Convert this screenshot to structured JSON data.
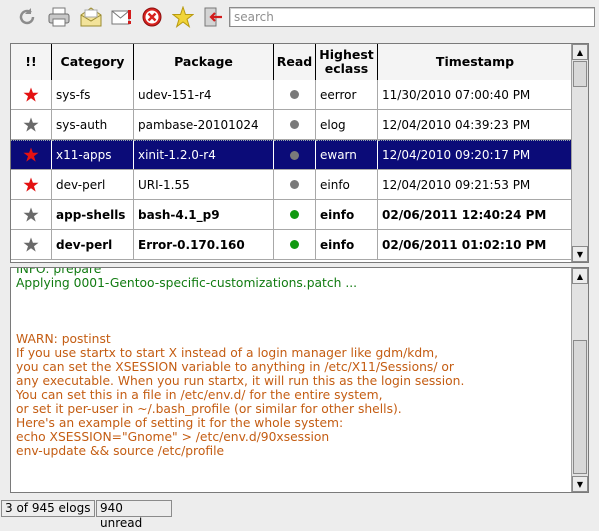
{
  "toolbar": {
    "icons": [
      "refresh-icon",
      "print-icon",
      "mail-open-icon",
      "mail-icon",
      "cancel-icon",
      "star-icon",
      "exit-icon"
    ],
    "search_placeholder": "search"
  },
  "table": {
    "headers": [
      "!!",
      "Category",
      "Package",
      "Read",
      "Highest eclass",
      "Timestamp"
    ],
    "rows": [
      {
        "star": "red",
        "category": "sys-fs",
        "package": "udev-151-r4",
        "read": "grey",
        "eclass": "eerror",
        "timestamp": "11/30/2010 07:00:40 PM",
        "selected": false,
        "unread": false
      },
      {
        "star": "grey",
        "category": "sys-auth",
        "package": "pambase-20101024",
        "read": "grey",
        "eclass": "elog",
        "timestamp": "12/04/2010 04:39:23 PM",
        "selected": false,
        "unread": false
      },
      {
        "star": "red",
        "category": "x11-apps",
        "package": "xinit-1.2.0-r4",
        "read": "grey",
        "eclass": "ewarn",
        "timestamp": "12/04/2010 09:20:17 PM",
        "selected": true,
        "unread": false
      },
      {
        "star": "red",
        "category": "dev-perl",
        "package": "URI-1.55",
        "read": "grey",
        "eclass": "einfo",
        "timestamp": "12/04/2010 09:21:53 PM",
        "selected": false,
        "unread": false
      },
      {
        "star": "grey",
        "category": "app-shells",
        "package": "bash-4.1_p9",
        "read": "green",
        "eclass": "einfo",
        "timestamp": "02/06/2011 12:40:24 PM",
        "selected": false,
        "unread": true
      },
      {
        "star": "grey",
        "category": "dev-perl",
        "package": "Error-0.170.160",
        "read": "green",
        "eclass": "einfo",
        "timestamp": "02/06/2011 01:02:10 PM",
        "selected": false,
        "unread": true
      }
    ]
  },
  "colors": {
    "star_red": "#e41212",
    "star_grey": "#6a6a6a",
    "read_grey": "#7a7a7a",
    "read_green": "#119a11",
    "selection": "#0b0b78",
    "log_green": "#117b11",
    "log_orange": "#c45d13"
  },
  "log": {
    "lines": [
      {
        "text": "INFO: prepare",
        "color": "green"
      },
      {
        "text": "Applying 0001-Gentoo-specific-customizations.patch ...",
        "color": "green"
      },
      {
        "text": "",
        "color": "green"
      },
      {
        "text": "",
        "color": "green"
      },
      {
        "text": "",
        "color": "green"
      },
      {
        "text": "WARN: postinst",
        "color": "orange"
      },
      {
        "text": "If you use startx to start X instead of a login manager like gdm/kdm,",
        "color": "orange"
      },
      {
        "text": "you can set the XSESSION variable to anything in /etc/X11/Sessions/ or",
        "color": "orange"
      },
      {
        "text": "any executable. When you run startx, it will run this as the login session.",
        "color": "orange"
      },
      {
        "text": "You can set this in a file in /etc/env.d/ for the entire system,",
        "color": "orange"
      },
      {
        "text": "or set it per-user in ~/.bash_profile (or similar for other shells).",
        "color": "orange"
      },
      {
        "text": "Here's an example of setting it for the whole system:",
        "color": "orange"
      },
      {
        "text": "echo XSESSION=\"Gnome\" > /etc/env.d/90xsession",
        "color": "orange"
      },
      {
        "text": "env-update && source /etc/profile",
        "color": "orange"
      }
    ]
  },
  "status": {
    "count": "3 of 945 elogs",
    "unread": "940 unread"
  }
}
